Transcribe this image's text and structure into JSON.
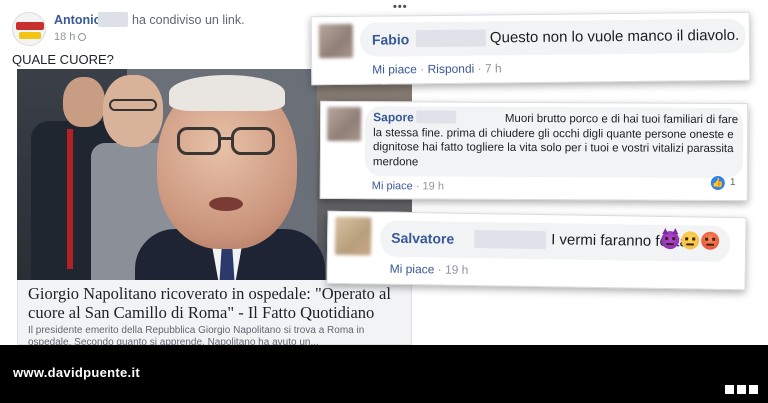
{
  "post": {
    "author": "Antonio",
    "action": "ha condiviso un link.",
    "time": "18 h",
    "text": "QUALE CUORE?",
    "link": {
      "title": "Giorgio Napolitano ricoverato in ospedale: \"Operato al cuore al San Camillo di Roma\" - Il Fatto Quotidiano",
      "description": "Il presidente emerito della Repubblica Giorgio Napolitano si trova a Roma in ospedale. Secondo quanto si apprende, Napolitano ha avuto un..."
    }
  },
  "menu_ellipsis": "•••",
  "comments": [
    {
      "name": "Fabio",
      "text": "Questo non lo vuole manco il diavolo.",
      "like": "Mi piace",
      "sep1": " · ",
      "reply": "Rispondi",
      "sep2": " · ",
      "time": "7 h"
    },
    {
      "name": "Sapore",
      "text": "Muori brutto porco e di hai tuoi familiari di fare la stessa fine. prima di chiudere gli occhi digli quante persone oneste e dignitose hai fatto togliere la vita solo per i tuoi e vostri vitalizi parassita merdone",
      "like": "Mi piace",
      "sep1": " · ",
      "time": "19 h",
      "reactions": "1"
    },
    {
      "name": "Salvatore",
      "text": "I vermi faranno festa",
      "like": "Mi piace",
      "sep1": " · ",
      "time": "19 h",
      "emojis": [
        "devil-emoji",
        "smirk-emoji",
        "angry-emoji"
      ]
    }
  ],
  "footer": {
    "site": "www.davidpuente.it"
  },
  "colors": {
    "link_blue": "#385898",
    "bubble_grey": "#f2f3f5",
    "footer_black": "#000000",
    "like_blue": "#2e82f0"
  }
}
